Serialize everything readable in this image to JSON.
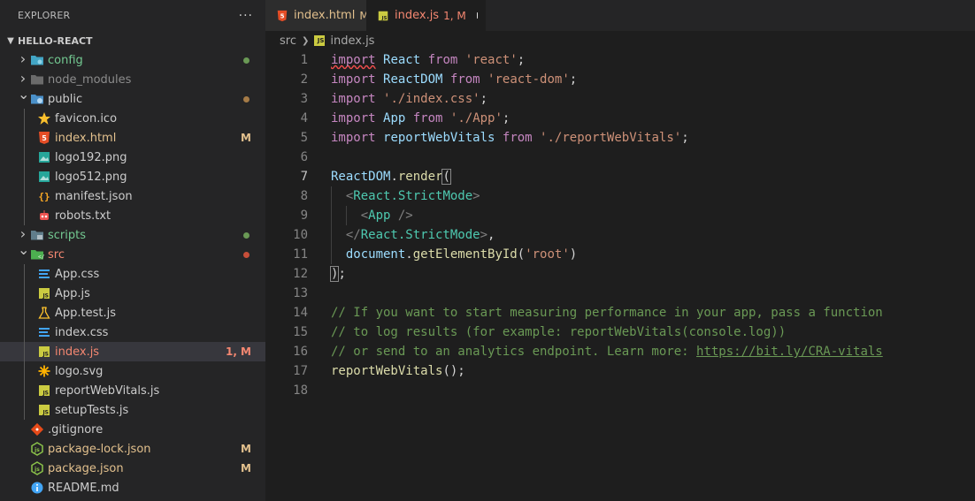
{
  "explorer": {
    "title": "EXPLORER",
    "more": "···",
    "section": "HELLO-REACT",
    "items": [
      {
        "label": "config",
        "type": "folder",
        "depth": 1,
        "expanded": false,
        "color": "#73c991",
        "icon": "folder-config-icon",
        "dot": "#6a9955"
      },
      {
        "label": "node_modules",
        "type": "folder",
        "depth": 1,
        "expanded": false,
        "color": "#8c8c8c",
        "icon": "folder-node-icon"
      },
      {
        "label": "public",
        "type": "folder",
        "depth": 1,
        "expanded": true,
        "color": "#cccccc",
        "icon": "folder-public-icon",
        "dot": "#a57b47"
      },
      {
        "label": "favicon.ico",
        "type": "file",
        "depth": 2,
        "color": "#cccccc",
        "icon": "star-icon"
      },
      {
        "label": "index.html",
        "type": "file",
        "depth": 2,
        "color": "#e2c08d",
        "icon": "html-icon",
        "deco": "M"
      },
      {
        "label": "logo192.png",
        "type": "file",
        "depth": 2,
        "color": "#cccccc",
        "icon": "image-icon"
      },
      {
        "label": "logo512.png",
        "type": "file",
        "depth": 2,
        "color": "#cccccc",
        "icon": "image-icon"
      },
      {
        "label": "manifest.json",
        "type": "file",
        "depth": 2,
        "color": "#cccccc",
        "icon": "json-icon"
      },
      {
        "label": "robots.txt",
        "type": "file",
        "depth": 2,
        "color": "#cccccc",
        "icon": "robot-icon"
      },
      {
        "label": "scripts",
        "type": "folder",
        "depth": 1,
        "expanded": false,
        "color": "#73c991",
        "icon": "folder-scripts-icon",
        "dot": "#6a9955"
      },
      {
        "label": "src",
        "type": "folder",
        "depth": 1,
        "expanded": true,
        "color": "#f48771",
        "icon": "folder-src-icon",
        "dot": "#c74e39"
      },
      {
        "label": "App.css",
        "type": "file",
        "depth": 2,
        "color": "#cccccc",
        "icon": "css-icon"
      },
      {
        "label": "App.js",
        "type": "file",
        "depth": 2,
        "color": "#cccccc",
        "icon": "js-icon"
      },
      {
        "label": "App.test.js",
        "type": "file",
        "depth": 2,
        "color": "#cccccc",
        "icon": "test-icon"
      },
      {
        "label": "index.css",
        "type": "file",
        "depth": 2,
        "color": "#cccccc",
        "icon": "css-icon"
      },
      {
        "label": "index.js",
        "type": "file",
        "depth": 2,
        "color": "#f48771",
        "icon": "js-icon",
        "deco": "1, M",
        "selected": true
      },
      {
        "label": "logo.svg",
        "type": "file",
        "depth": 2,
        "color": "#cccccc",
        "icon": "svg-icon"
      },
      {
        "label": "reportWebVitals.js",
        "type": "file",
        "depth": 2,
        "color": "#cccccc",
        "icon": "js-icon"
      },
      {
        "label": "setupTests.js",
        "type": "file",
        "depth": 2,
        "color": "#cccccc",
        "icon": "js-icon"
      },
      {
        "label": ".gitignore",
        "type": "file",
        "depth": 1,
        "color": "#cccccc",
        "icon": "git-icon"
      },
      {
        "label": "package-lock.json",
        "type": "file",
        "depth": 1,
        "color": "#e2c08d",
        "icon": "node-icon",
        "deco": "M"
      },
      {
        "label": "package.json",
        "type": "file",
        "depth": 1,
        "color": "#e2c08d",
        "icon": "node-icon",
        "deco": "M"
      },
      {
        "label": "README.md",
        "type": "file",
        "depth": 1,
        "color": "#cccccc",
        "icon": "info-icon"
      }
    ]
  },
  "tabs": [
    {
      "label": "index.html",
      "deco": "M",
      "active": false,
      "icon": "html-icon"
    },
    {
      "label": "index.js",
      "deco": "1, M",
      "active": true,
      "icon": "js-icon",
      "dirty": true
    }
  ],
  "breadcrumb": {
    "folder": "src",
    "file": "index.js",
    "file_icon_text": "JS"
  },
  "colors": {
    "selection": "#37373d",
    "modified": "#e2c08d",
    "error": "#f48771",
    "untracked": "#73c991"
  },
  "code": {
    "current_line": 7,
    "lines": [
      [
        [
          "import",
          "kw squig"
        ],
        [
          " ",
          "pl"
        ],
        [
          "React",
          "id"
        ],
        [
          " ",
          "pl"
        ],
        [
          "from",
          "kw"
        ],
        [
          " ",
          "pl"
        ],
        [
          "'react'",
          "str"
        ],
        [
          ";",
          "pl"
        ]
      ],
      [
        [
          "import",
          "kw"
        ],
        [
          " ",
          "pl"
        ],
        [
          "ReactDOM",
          "id"
        ],
        [
          " ",
          "pl"
        ],
        [
          "from",
          "kw"
        ],
        [
          " ",
          "pl"
        ],
        [
          "'react-dom'",
          "str"
        ],
        [
          ";",
          "pl"
        ]
      ],
      [
        [
          "import",
          "kw"
        ],
        [
          " ",
          "pl"
        ],
        [
          "'./index.css'",
          "str"
        ],
        [
          ";",
          "pl"
        ]
      ],
      [
        [
          "import",
          "kw"
        ],
        [
          " ",
          "pl"
        ],
        [
          "App",
          "id"
        ],
        [
          " ",
          "pl"
        ],
        [
          "from",
          "kw"
        ],
        [
          " ",
          "pl"
        ],
        [
          "'./App'",
          "str"
        ],
        [
          ";",
          "pl"
        ]
      ],
      [
        [
          "import",
          "kw"
        ],
        [
          " ",
          "pl"
        ],
        [
          "reportWebVitals",
          "id"
        ],
        [
          " ",
          "pl"
        ],
        [
          "from",
          "kw"
        ],
        [
          " ",
          "pl"
        ],
        [
          "'./reportWebVitals'",
          "str"
        ],
        [
          ";",
          "pl"
        ]
      ],
      [],
      [
        [
          "ReactDOM",
          "id"
        ],
        [
          ".",
          "pl"
        ],
        [
          "render",
          "fn"
        ],
        [
          "(",
          "pl bracket-hl"
        ]
      ],
      [
        [
          "  ",
          "pl"
        ],
        [
          "<",
          "br"
        ],
        [
          "React.StrictMode",
          "tag"
        ],
        [
          ">",
          "br"
        ]
      ],
      [
        [
          "    ",
          "pl"
        ],
        [
          "<",
          "br"
        ],
        [
          "App",
          "tag"
        ],
        [
          " />",
          "br"
        ]
      ],
      [
        [
          "  ",
          "pl"
        ],
        [
          "</",
          "br"
        ],
        [
          "React.StrictMode",
          "tag"
        ],
        [
          ">",
          "br"
        ],
        [
          ",",
          "pl"
        ]
      ],
      [
        [
          "  ",
          "pl"
        ],
        [
          "document",
          "id"
        ],
        [
          ".",
          "pl"
        ],
        [
          "getElementById",
          "fn"
        ],
        [
          "(",
          "pl"
        ],
        [
          "'root'",
          "str"
        ],
        [
          ")",
          "pl"
        ]
      ],
      [
        [
          ")",
          "pl bracket-hl"
        ],
        [
          ";",
          "pl"
        ]
      ],
      [],
      [
        [
          "// If you want to start measuring performance in your app, pass a function",
          "cm"
        ]
      ],
      [
        [
          "// to log results (for example: reportWebVitals(console.log))",
          "cm"
        ]
      ],
      [
        [
          "// or send to an analytics endpoint. Learn more: ",
          "cm"
        ],
        [
          "https://bit.ly/CRA-vitals",
          "cm link"
        ]
      ],
      [
        [
          "reportWebVitals",
          "fn"
        ],
        [
          "();",
          "pl"
        ]
      ],
      []
    ]
  }
}
